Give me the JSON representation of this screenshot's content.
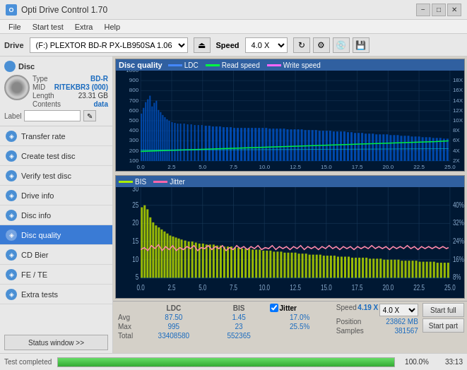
{
  "titlebar": {
    "title": "Opti Drive Control 1.70",
    "icon": "O",
    "min_label": "−",
    "max_label": "□",
    "close_label": "✕"
  },
  "menubar": {
    "items": [
      "File",
      "Start test",
      "Extra",
      "Help"
    ]
  },
  "drivebar": {
    "drive_label": "Drive",
    "drive_value": "(F:)  PLEXTOR BD-R  PX-LB950SA 1.06",
    "speed_label": "Speed",
    "speed_value": "4.0 X"
  },
  "disc": {
    "header": "Disc",
    "type_label": "Type",
    "type_val": "BD-R",
    "mid_label": "MID",
    "mid_val": "RITEKBR3 (000)",
    "length_label": "Length",
    "length_val": "23.31 GB",
    "contents_label": "Contents",
    "contents_val": "data",
    "label_label": "Label"
  },
  "nav": {
    "items": [
      {
        "id": "transfer-rate",
        "label": "Transfer rate",
        "active": false
      },
      {
        "id": "create-test-disc",
        "label": "Create test disc",
        "active": false
      },
      {
        "id": "verify-test-disc",
        "label": "Verify test disc",
        "active": false
      },
      {
        "id": "drive-info",
        "label": "Drive info",
        "active": false
      },
      {
        "id": "disc-info",
        "label": "Disc info",
        "active": false
      },
      {
        "id": "disc-quality",
        "label": "Disc quality",
        "active": true
      },
      {
        "id": "cd-bier",
        "label": "CD Bier",
        "active": false
      },
      {
        "id": "fe-te",
        "label": "FE / TE",
        "active": false
      },
      {
        "id": "extra-tests",
        "label": "Extra tests",
        "active": false
      }
    ],
    "status_btn": "Status window >>"
  },
  "upper_chart": {
    "title": "Disc quality",
    "legends": [
      {
        "label": "LDC",
        "color": "#0080ff"
      },
      {
        "label": "Read speed",
        "color": "#00ff40"
      },
      {
        "label": "Write speed",
        "color": "#ff66ff"
      }
    ],
    "y_max": 1000,
    "y_right_max": 18,
    "x_max": 25,
    "x_labels": [
      "0.0",
      "2.5",
      "5.0",
      "7.5",
      "10.0",
      "12.5",
      "15.0",
      "17.5",
      "20.0",
      "22.5",
      "25.0"
    ],
    "y_labels": [
      "100",
      "200",
      "300",
      "400",
      "500",
      "600",
      "700",
      "800",
      "900",
      "1000"
    ],
    "y_right_labels": [
      "2X",
      "4X",
      "6X",
      "8X",
      "10X",
      "12X",
      "14X",
      "16X",
      "18X"
    ]
  },
  "lower_chart": {
    "legends": [
      {
        "label": "BIS",
        "color": "#ffff00"
      },
      {
        "label": "Jitter",
        "color": "#ff66aa"
      }
    ],
    "y_max": 30,
    "y_right_max": 40,
    "x_max": 25,
    "x_labels": [
      "0.0",
      "2.5",
      "5.0",
      "7.5",
      "10.0",
      "12.5",
      "15.0",
      "17.5",
      "20.0",
      "22.5",
      "25.0"
    ],
    "y_labels": [
      "5",
      "10",
      "15",
      "20",
      "25",
      "30"
    ],
    "y_right_labels": [
      "8%",
      "16%",
      "24%",
      "32%",
      "40%"
    ]
  },
  "stats": {
    "ldc_label": "LDC",
    "bis_label": "BIS",
    "jitter_label": "Jitter",
    "speed_label": "Speed",
    "speed_val": "4.19 X",
    "speed_select": "4.0 X",
    "avg_label": "Avg",
    "avg_ldc": "87.50",
    "avg_bis": "1.45",
    "avg_jitter": "17.0%",
    "max_label": "Max",
    "max_ldc": "995",
    "max_bis": "23",
    "max_jitter": "25.5%",
    "position_label": "Position",
    "position_val": "23862 MB",
    "total_label": "Total",
    "total_ldc": "33408580",
    "total_bis": "552365",
    "samples_label": "Samples",
    "samples_val": "381567",
    "start_full_label": "Start full",
    "start_part_label": "Start part"
  },
  "bottombar": {
    "status_label": "Test completed",
    "progress_pct": "100.0%",
    "time": "33:13"
  }
}
